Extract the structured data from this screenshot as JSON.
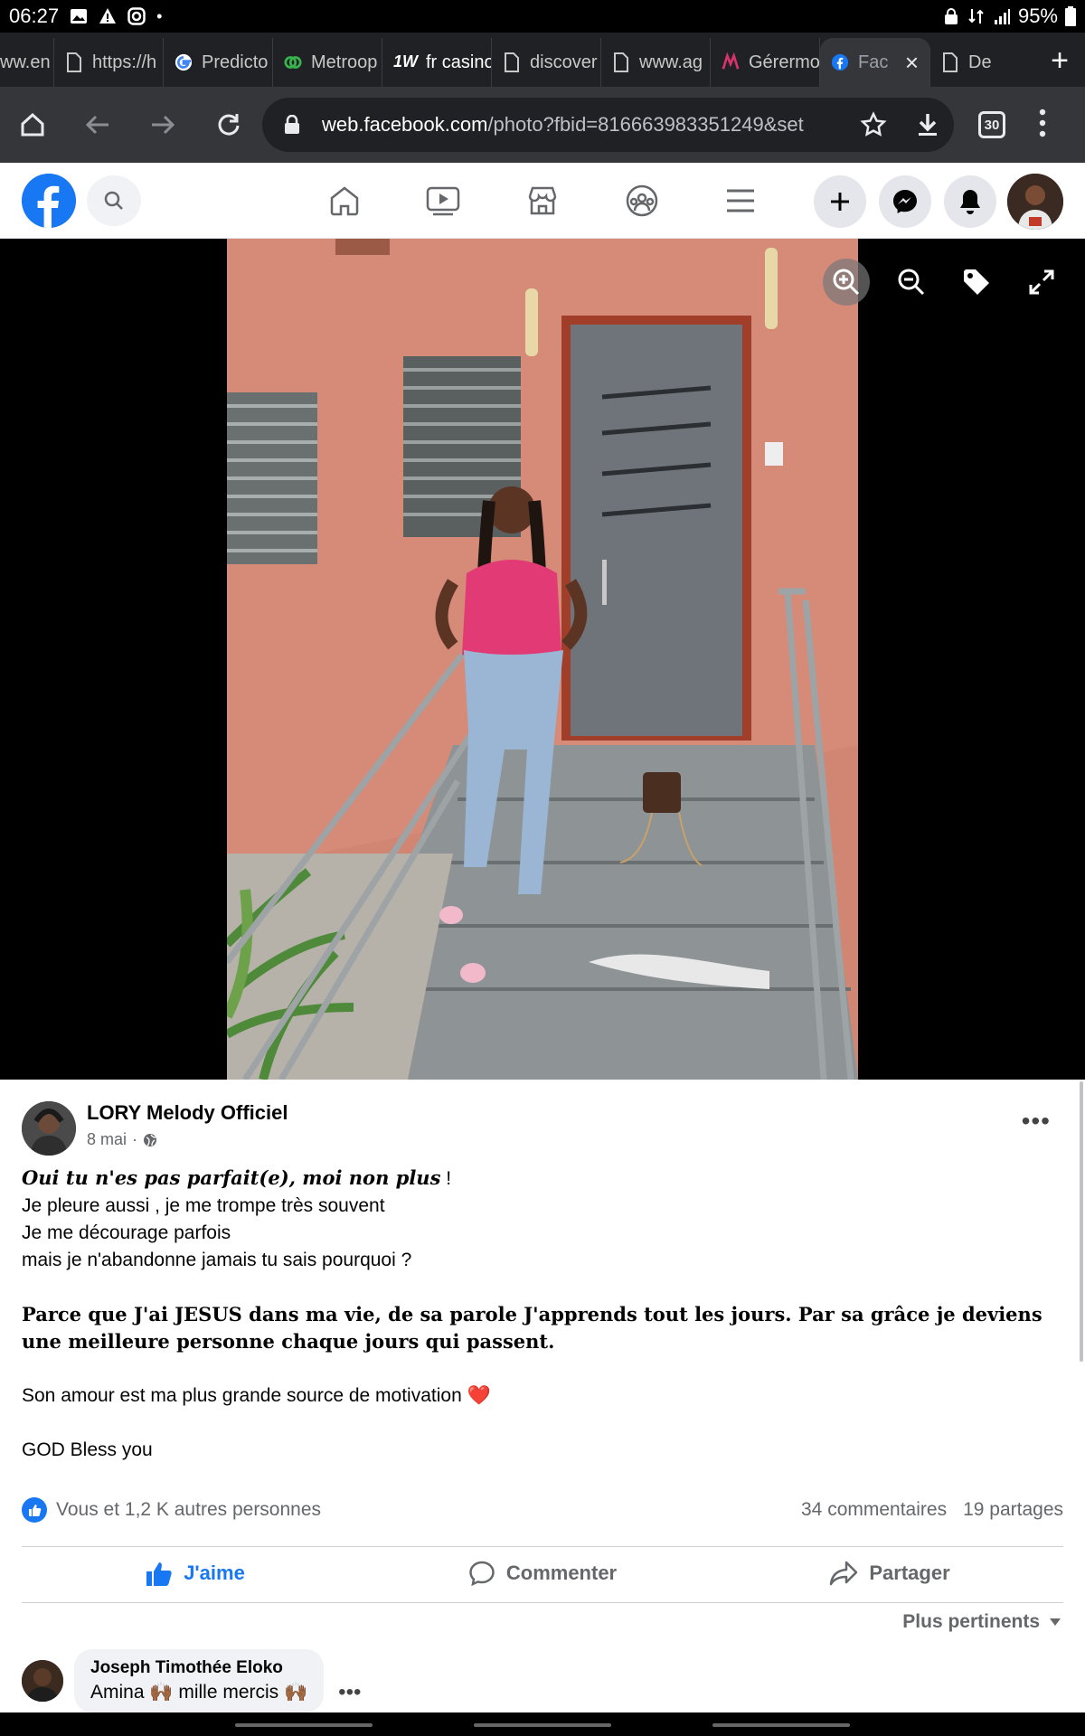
{
  "statusbar": {
    "time": "06:27",
    "battery": "95%"
  },
  "tabs": [
    {
      "label": "ww.en",
      "icon": "page-icon"
    },
    {
      "label": "https://h",
      "icon": "page-icon"
    },
    {
      "label": "Predicto",
      "icon": "google-icon"
    },
    {
      "label": "Metroop",
      "icon": "metro-icon"
    },
    {
      "label": "fr casino",
      "icon": "1w-icon"
    },
    {
      "label": "discover",
      "icon": "page-icon"
    },
    {
      "label": "www.ag",
      "icon": "page-icon"
    },
    {
      "label": "Gérermo",
      "icon": "meta-icon"
    },
    {
      "label": "Fac",
      "icon": "facebook-icon",
      "active": true
    },
    {
      "label": "De",
      "icon": "page-icon"
    }
  ],
  "toolbar": {
    "url_host": "web.facebook.com",
    "url_path": "/photo?fbid=816663983351249&set",
    "tab_count": "30"
  },
  "post": {
    "author": "LORY Melody Officiel",
    "date": "8 mai",
    "line1": "Oui tu n'es pas parfait(e), moi non plus",
    "line1_tail": " !",
    "line2": "Je pleure aussi , je me trompe très souvent",
    "line3": "Je me décourage parfois",
    "line4": "mais je n'abandonne jamais tu sais pourquoi ?",
    "line5": "Parce que J'ai JESUS dans ma vie, de sa parole J'apprends tout les jours. Par sa grâce je deviens une meilleure personne chaque jours qui passent.",
    "line6": "Son amour est ma plus grande source de motivation",
    "line6_emoji": "❤️",
    "line7": "GOD Bless you",
    "reactions_text": "Vous et 1,2 K autres personnes",
    "comments_count": "34 commentaires",
    "shares_count": "19 partages"
  },
  "actions": {
    "like": "J'aime",
    "comment": "Commenter",
    "share": "Partager"
  },
  "sort_label": "Plus pertinents",
  "comment": {
    "author": "Joseph Timothée Eloko",
    "text": "Amina 🙌🏾 mille mercis 🙌🏾"
  },
  "colors": {
    "facebook_blue": "#1877f2",
    "chrome_dark": "#35363a"
  }
}
